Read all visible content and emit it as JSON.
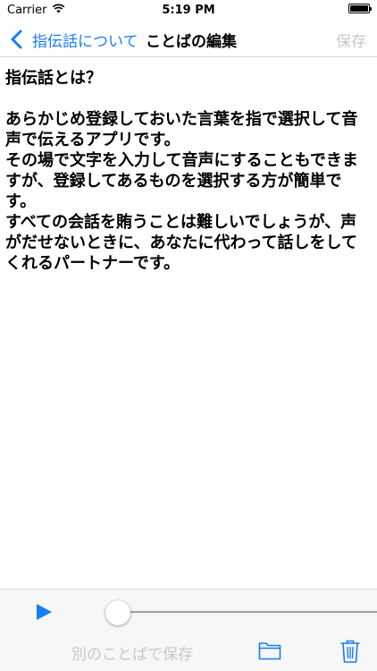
{
  "status_bar": {
    "carrier": "Carrier",
    "time": "5:19 PM",
    "battery_level": 1.0
  },
  "nav": {
    "back_label": "指伝話について",
    "title": "ことばの編集",
    "save_label": "保存"
  },
  "editor": {
    "text": "指伝話とは？\n\nあらかじめ登録しておいた言葉を指で選択して音声で伝えるアプリです。\nその場で文字を入力して音声にすることもできますが、登録してあるものを選択する方が簡単です。\nすべての会話を賄うことは難しいでしょうが、声がだせないときに、あなたに代わって話しをしてくれるパートナーです。"
  },
  "player": {
    "progress": 0.0
  },
  "toolbar": {
    "save_as_label": "別のことばで保存"
  },
  "colors": {
    "accent": "#1a7cf5",
    "disabled": "#c7c7cc",
    "bar_background": "#f7f7f7"
  },
  "icons": {
    "back": "chevron-left-icon",
    "wifi": "wifi-icon",
    "battery": "battery-icon",
    "play": "play-icon",
    "folder": "folder-icon",
    "trash": "trash-icon"
  }
}
